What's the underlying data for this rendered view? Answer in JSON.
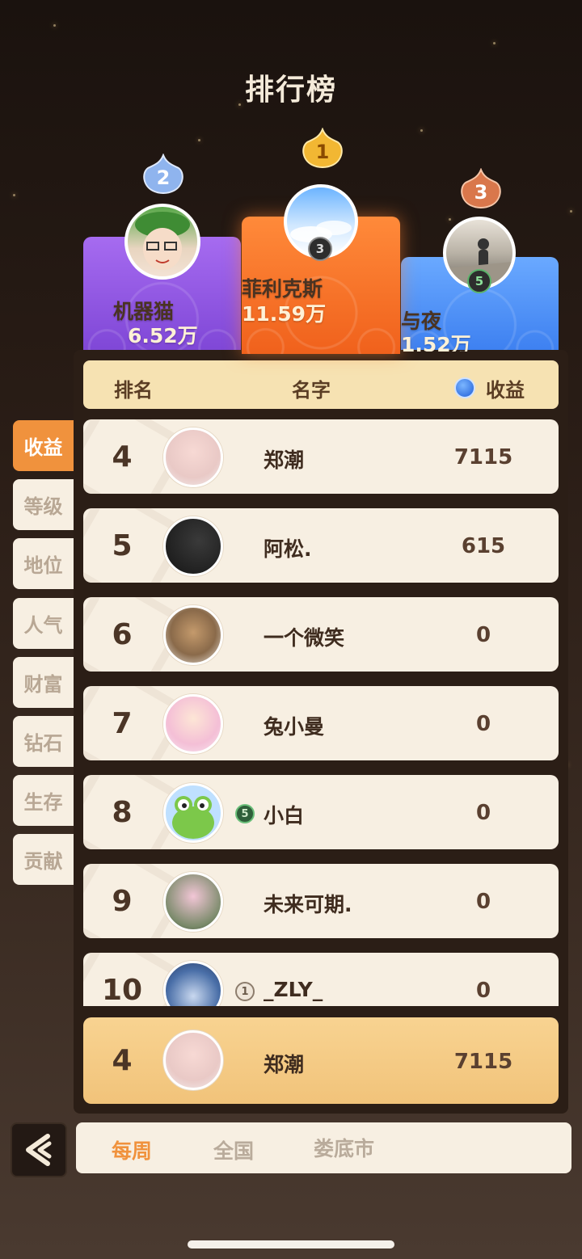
{
  "title": "排行榜",
  "colors": {
    "active_tab": "#f0923d",
    "rank2_podium": "#8e56e0",
    "rank1_podium": "#f46d24",
    "rank3_podium": "#4a8cf5",
    "my_row": "#f5c97f"
  },
  "podium": [
    {
      "rank": "2",
      "name": "机器猫",
      "value": "6.52万"
    },
    {
      "rank": "1",
      "name": "菲利克斯",
      "value": "11.59万",
      "level": "3"
    },
    {
      "rank": "3",
      "name": "与夜",
      "value": "1.52万",
      "level": "5"
    }
  ],
  "table_header": {
    "rank": "排名",
    "name": "名字",
    "score": "收益",
    "score_icon": "blue-coin-icon"
  },
  "rows": [
    {
      "rank": "4",
      "name": "郑潮",
      "score": "7115"
    },
    {
      "rank": "5",
      "name": "阿松.",
      "score": "615"
    },
    {
      "rank": "6",
      "name": "一个微笑",
      "score": "0"
    },
    {
      "rank": "7",
      "name": "兔小曼",
      "score": "0"
    },
    {
      "rank": "8",
      "name": "小白",
      "score": "0",
      "badge": "5"
    },
    {
      "rank": "9",
      "name": "未来可期.",
      "score": "0"
    },
    {
      "rank": "10",
      "name": "_ZLY_",
      "score": "0",
      "badge": "1"
    }
  ],
  "my_row": {
    "rank": "4",
    "name": "郑潮",
    "score": "7115"
  },
  "side_tabs": [
    "收益",
    "等级",
    "地位",
    "人气",
    "财富",
    "钻石",
    "生存",
    "贡献"
  ],
  "active_side_tab": "收益",
  "bottom_tabs": [
    "每周",
    "全国",
    "娄底市"
  ],
  "active_bottom_tab": "每周"
}
